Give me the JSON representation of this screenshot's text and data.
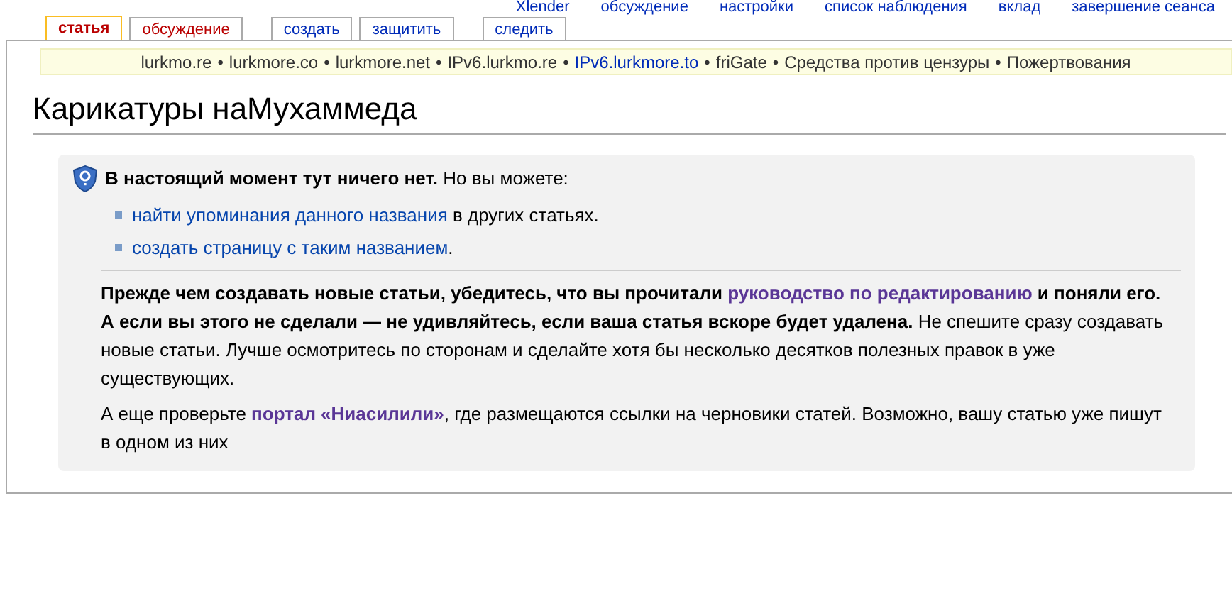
{
  "personal_links": [
    "Xlender",
    "обсуждение",
    "настройки",
    "список наблюдения",
    "вклад",
    "завершение сеанса"
  ],
  "tabs": [
    {
      "label": "статья",
      "selected": true,
      "missing": false
    },
    {
      "label": "обсуждение",
      "selected": false,
      "missing": true
    },
    {
      "label": "создать",
      "selected": false,
      "missing": false
    },
    {
      "label": "защитить",
      "selected": false,
      "missing": false
    },
    {
      "label": "следить",
      "selected": false,
      "missing": false
    }
  ],
  "mirror_bar": [
    {
      "kind": "entry",
      "label": "lurkmo.re",
      "link": false
    },
    {
      "label": "•",
      "kind": "separator"
    },
    {
      "kind": "entry",
      "label": "lurkmore.co",
      "link": false
    },
    {
      "label": "•",
      "kind": "separator"
    },
    {
      "kind": "entry",
      "label": "lurkmore.net",
      "link": false
    },
    {
      "label": "•",
      "kind": "separator"
    },
    {
      "kind": "entry",
      "label": "IPv6.lurkmo.re",
      "link": false
    },
    {
      "label": "•",
      "kind": "separator"
    },
    {
      "kind": "entry",
      "label": "IPv6.lurkmore.to",
      "link": true
    },
    {
      "label": "•",
      "kind": "separator"
    },
    {
      "kind": "entry",
      "label": "friGate",
      "link": false
    },
    {
      "label": "•",
      "kind": "separator"
    },
    {
      "kind": "entry",
      "label": "Средства против цензуры",
      "link": false
    },
    {
      "label": "•",
      "kind": "separator"
    },
    {
      "kind": "entry",
      "label": "Пожертвования",
      "link": false
    }
  ],
  "title": "Карикатуры наМухаммеда",
  "notice": {
    "heading": [
      {
        "kind": "bold",
        "text": "В настоящий момент тут ничего нет."
      },
      {
        "kind": "plain",
        "text": " Но вы можете:"
      }
    ],
    "options": [
      [
        {
          "kind": "link",
          "visited": false,
          "text": "найти упоминания данного названия"
        },
        {
          "kind": "plain",
          "text": " в других статьях."
        }
      ],
      [
        {
          "kind": "link",
          "visited": false,
          "text": "создать страницу с таким названием"
        },
        {
          "kind": "plain",
          "text": "."
        }
      ]
    ],
    "paragraphs": [
      [
        {
          "kind": "bold",
          "text": "Прежде чем создавать новые статьи, убедитесь, что вы прочитали "
        },
        {
          "kind": "link",
          "visited": true,
          "text": "руководство по редактированию"
        },
        {
          "kind": "bold",
          "text": " и поняли его. А если вы этого не сделали — не удивляйтесь, если ваша статья вскоре будет удалена."
        },
        {
          "kind": "plain",
          "text": " Не спешите сразу создавать новые статьи. Лучше осмотритесь по сторонам и сделайте хотя бы несколько десятков полезных правок в уже существующих."
        }
      ],
      [
        {
          "kind": "plain",
          "text": "А еще проверьте "
        },
        {
          "kind": "link",
          "visited": true,
          "text": "портал «Ниасилили»"
        },
        {
          "kind": "plain",
          "text": ", где размещаются ссылки на черновики статей. Возможно, вашу статью уже пишут в одном из них"
        }
      ]
    ]
  }
}
